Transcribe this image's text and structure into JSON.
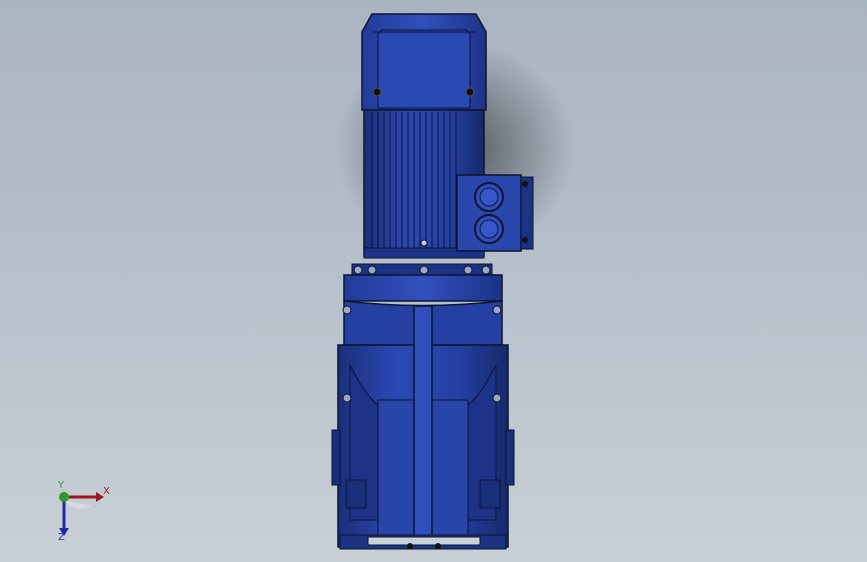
{
  "viewport": {
    "background_top": "#a9b4c1",
    "background_bottom": "#c9d0d6"
  },
  "model": {
    "body_color": "#233fa0",
    "shadow_color": "#1a2f7a",
    "highlight_color": "#3556c8",
    "outline_color": "#0b1430"
  },
  "triad": {
    "x_label": "X",
    "y_label": "Y",
    "z_label": "Z",
    "x_color": "#a0151a",
    "y_color": "#2a9a2a",
    "z_color": "#1e2aa8"
  }
}
